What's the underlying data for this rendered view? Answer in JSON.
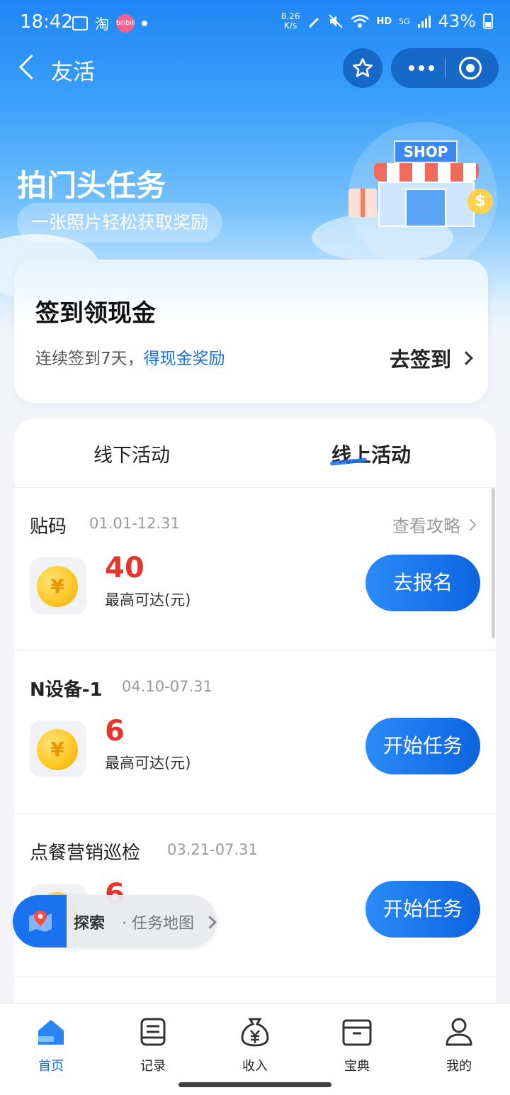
{
  "status_bar": {
    "time": "18:42",
    "app_icons": [
      "image-icon",
      "taobao-icon",
      "bilibili-icon"
    ],
    "taobao_glyph": "淘",
    "bilibili_text": "bilibili",
    "net_speed_value": "8.26",
    "net_speed_unit": "K/s",
    "hd_label": "HD",
    "signal_label": "5G",
    "battery": "43%"
  },
  "nav": {
    "title": "友活"
  },
  "hero": {
    "title": "拍门头任务",
    "subtitle": "一张照片轻松获取奖励",
    "shop_sign": "SHOP",
    "coin_symbol": "$"
  },
  "signin_card": {
    "title": "签到领现金",
    "desc_prefix": "连续签到7天，",
    "desc_highlight": "得现金奖励",
    "action": "去签到"
  },
  "tabs": [
    {
      "label": "线下活动",
      "active": false
    },
    {
      "label": "线上活动",
      "active": true
    }
  ],
  "tasks": [
    {
      "name": "贴码",
      "dates": "01.01-12.31",
      "guide": "查看攻略",
      "amount": "40",
      "amount_label": "最高可达(元)",
      "button": "去报名"
    },
    {
      "name": "N设备-1",
      "dates": "04.10-07.31",
      "amount": "6",
      "amount_label": "最高可达(元)",
      "button": "开始任务"
    },
    {
      "name": "点餐营销巡检",
      "dates": "03.21-07.31",
      "amount": "6",
      "button": "开始任务"
    }
  ],
  "coin_glyph": "¥",
  "explore": {
    "label": "探索",
    "sub": "· 任务地图"
  },
  "bottom_nav": [
    {
      "label": "首页",
      "icon": "home-icon",
      "active": true
    },
    {
      "label": "记录",
      "icon": "record-icon",
      "active": false
    },
    {
      "label": "收入",
      "icon": "money-bag-icon",
      "active": false
    },
    {
      "label": "宝典",
      "icon": "archive-box-icon",
      "active": false
    },
    {
      "label": "我的",
      "icon": "user-icon",
      "active": false
    }
  ],
  "colors": {
    "primary": "#1a6fe8",
    "accent_red": "#e8352a",
    "hero_top": "#1f86f5",
    "button_gradient_start": "#2a8cf8",
    "button_gradient_end": "#0d63e0"
  }
}
